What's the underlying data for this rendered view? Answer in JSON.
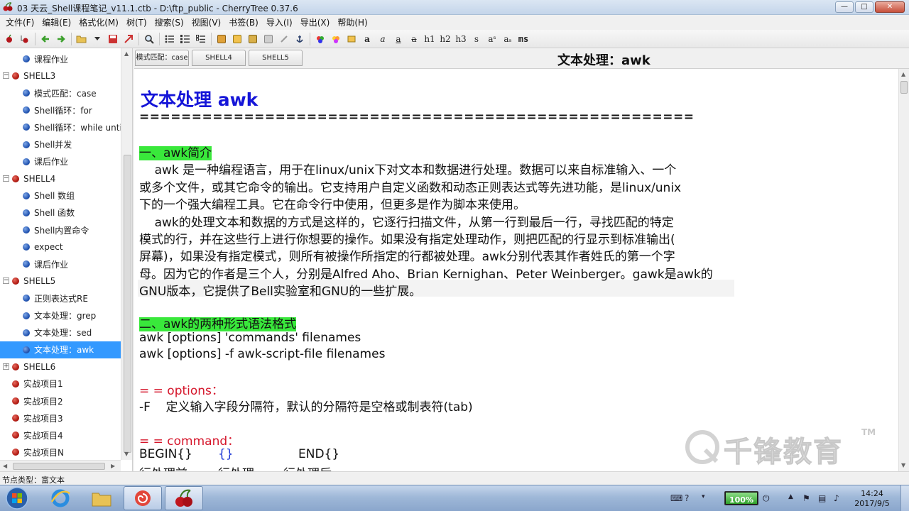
{
  "window": {
    "title": "03 天云_Shell课程笔记_v11.1.ctb - D:\\ftp_public - CherryTree 0.37.6",
    "buttons": {
      "minimize": "—",
      "maximize": "□",
      "close": "✕"
    }
  },
  "menubar": [
    "文件(F)",
    "编辑(E)",
    "格式化(M)",
    "树(T)",
    "搜索(S)",
    "视图(V)",
    "书签(B)",
    "导入(I)",
    "导出(X)",
    "帮助(H)"
  ],
  "toolbar": {
    "format_labels": [
      "a",
      "a",
      "a",
      "a",
      "h1",
      "h2",
      "h3",
      "s",
      "aˢ",
      "aₛ",
      "ms"
    ]
  },
  "tree": {
    "items": [
      {
        "label": "课程作业",
        "level": 1,
        "icon": "blue"
      },
      {
        "label": "SHELL3",
        "level": 0,
        "icon": "red",
        "expander": "−"
      },
      {
        "label": "模式匹配：case",
        "level": 1,
        "icon": "blue"
      },
      {
        "label": "Shell循环：for",
        "level": 1,
        "icon": "blue"
      },
      {
        "label": "Shell循环：while until",
        "level": 1,
        "icon": "blue"
      },
      {
        "label": "Shell并发",
        "level": 1,
        "icon": "blue"
      },
      {
        "label": "课后作业",
        "level": 1,
        "icon": "blue"
      },
      {
        "label": "SHELL4",
        "level": 0,
        "icon": "red",
        "expander": "−"
      },
      {
        "label": "Shell 数组",
        "level": 1,
        "icon": "blue"
      },
      {
        "label": "Shell 函数",
        "level": 1,
        "icon": "blue"
      },
      {
        "label": "Shell内置命令",
        "level": 1,
        "icon": "blue"
      },
      {
        "label": "expect",
        "level": 1,
        "icon": "blue"
      },
      {
        "label": "课后作业",
        "level": 1,
        "icon": "blue"
      },
      {
        "label": "SHELL5",
        "level": 0,
        "icon": "red",
        "expander": "−"
      },
      {
        "label": "正则表达式RE",
        "level": 1,
        "icon": "blue"
      },
      {
        "label": "文本处理：grep",
        "level": 1,
        "icon": "blue"
      },
      {
        "label": "文本处理：sed",
        "level": 1,
        "icon": "blue"
      },
      {
        "label": "文本处理：awk",
        "level": 1,
        "icon": "blue",
        "selected": true
      },
      {
        "label": "SHELL6",
        "level": 0,
        "icon": "red",
        "expander": "+"
      },
      {
        "label": "实战项目1",
        "level": 0,
        "icon": "red"
      },
      {
        "label": "实战项目2",
        "level": 0,
        "icon": "red"
      },
      {
        "label": "实战项目3",
        "level": 0,
        "icon": "red"
      },
      {
        "label": "实战项目4",
        "level": 0,
        "icon": "red"
      },
      {
        "label": "实战项目N",
        "level": 0,
        "icon": "red"
      }
    ]
  },
  "tabs": [
    {
      "label": "模式匹配：case"
    },
    {
      "label": "SHELL4"
    },
    {
      "label": "SHELL5"
    }
  ],
  "node_title": "文本处理：awk",
  "document": {
    "heading": "文本处理 awk",
    "rule": "=====================================================",
    "section1_title": "一、awk简介",
    "para1": [
      "    awk 是一种编程语言，用于在linux/unix下对文本和数据进行处理。数据可以来自标准输入、一个",
      "或多个文件，或其它命令的输出。它支持用户自定义函数和动态正则表达式等先进功能，是linux/unix",
      "下的一个强大编程工具。它在命令行中使用，但更多是作为脚本来使用。"
    ],
    "para2": [
      "    awk的处理文本和数据的方式是这样的，它逐行扫描文件，从第一行到最后一行，寻找匹配的特定",
      "模式的行，并在这些行上进行你想要的操作。如果没有指定处理动作，则把匹配的行显示到标准输出(",
      "屏幕)，如果没有指定模式，则所有被操作所指定的行都被处理。awk分别代表其作者姓氏的第一个字",
      "母。因为它的作者是三个人，分别是Alfred Aho、Brian Kernighan、Peter Weinberger。gawk是awk的",
      "GNU版本，它提供了Bell实验室和GNU的一些扩展。"
    ],
    "section2_title": "二、awk的两种形式语法格式",
    "syntax": [
      "awk [options] 'commands' filenames",
      "awk [options] -f awk-script-file filenames"
    ],
    "options_title": "= = options：",
    "option_f": "-F    定义输入字段分隔符，默认的分隔符是空格或制表符(tab)",
    "command_title": "= = command：",
    "command_row": {
      "begin": "BEGIN{}",
      "middle": "{}",
      "end": "END{}"
    },
    "command_row2": {
      "begin": "行处理前",
      "middle": "行处理",
      "end": "行处理后"
    }
  },
  "statusbar": {
    "text": "节点类型：富文本"
  },
  "watermark": {
    "text": "千锋教育",
    "tm": "TM"
  },
  "taskbar": {
    "battery_percent": "100%",
    "battery_level": 1.0,
    "time": "14:24",
    "date": "2017/9/5"
  }
}
